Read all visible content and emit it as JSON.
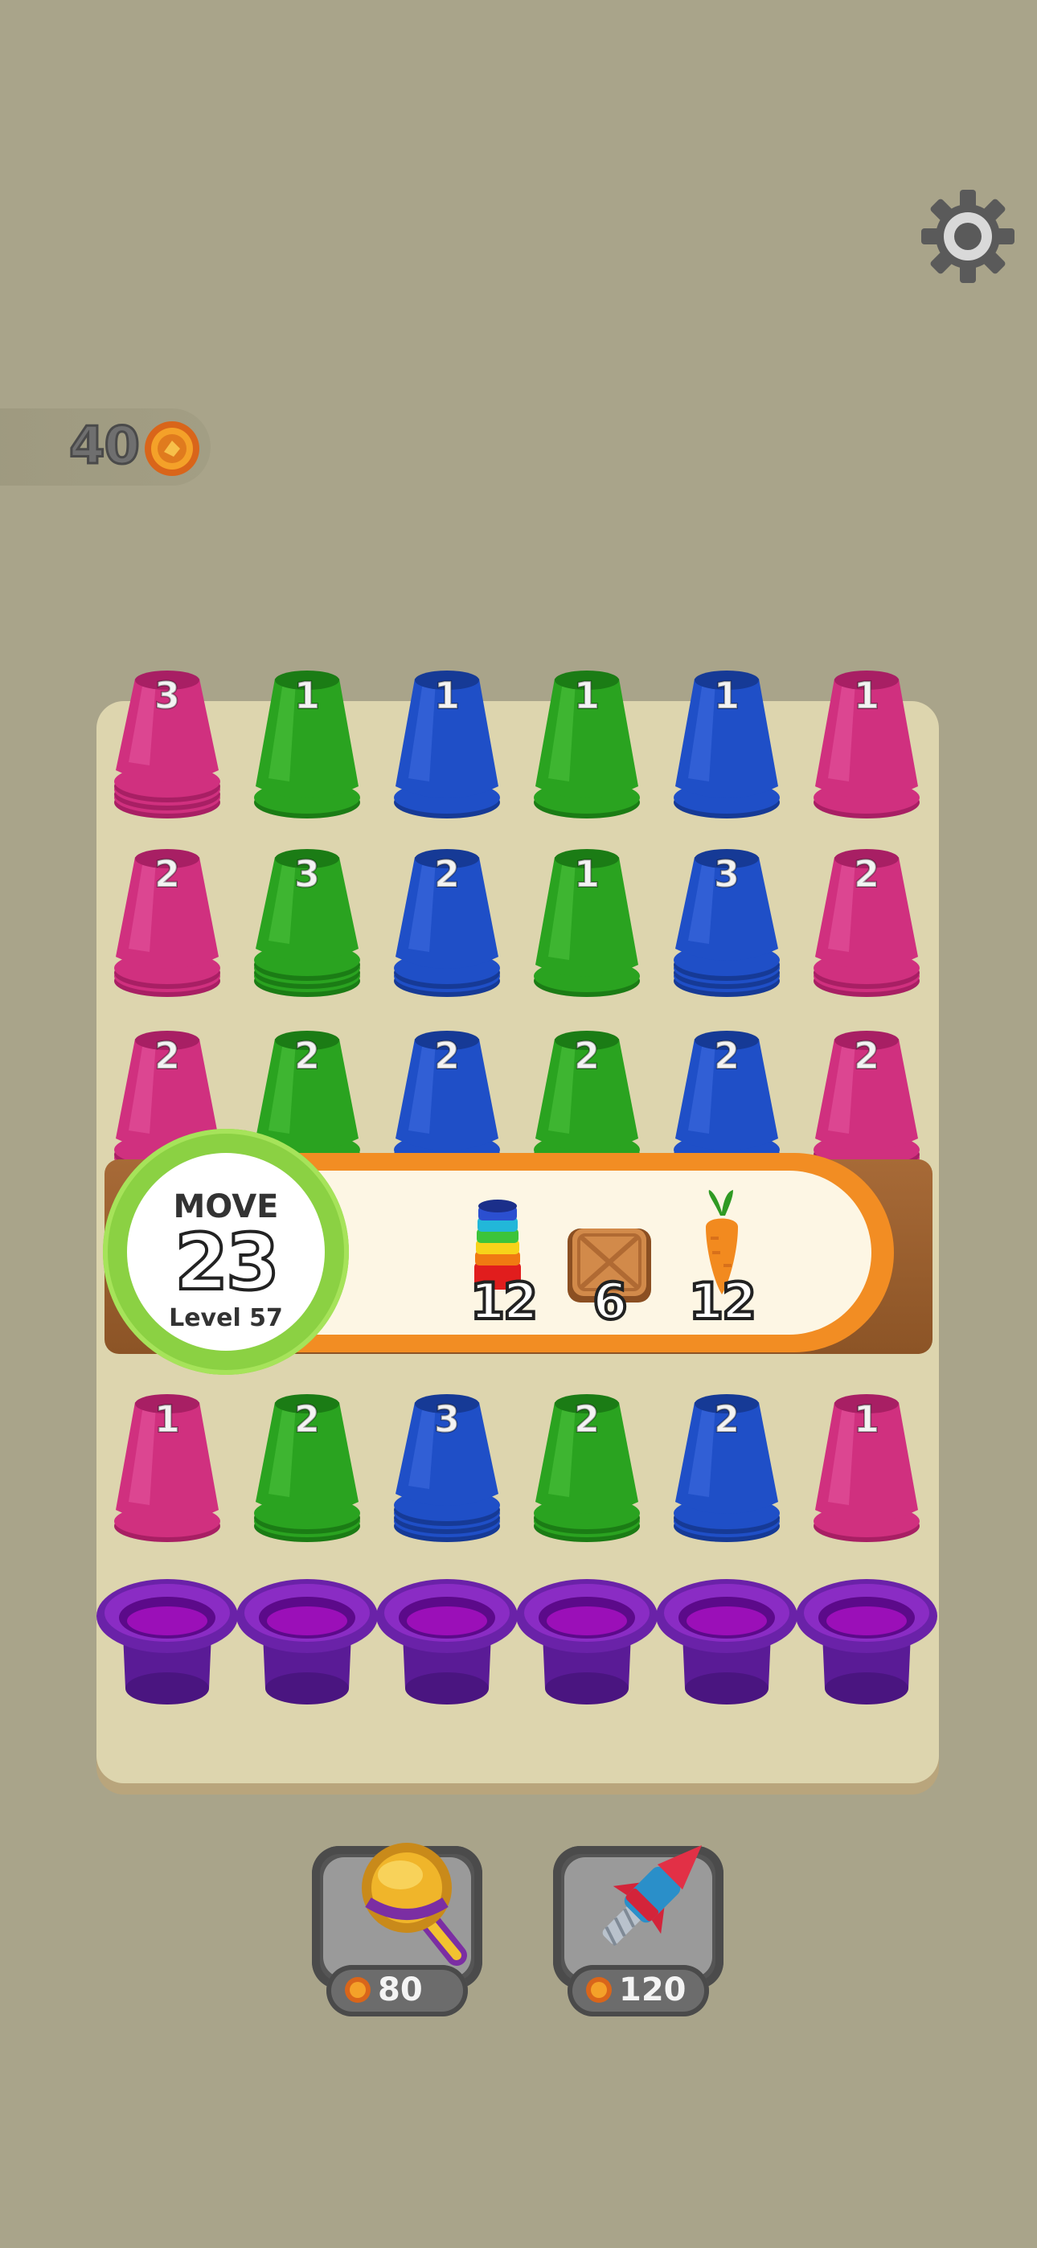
{
  "hud": {
    "coins": "40",
    "settings_icon": "gear-icon",
    "coin_icon": "coin-icon"
  },
  "board": {
    "colors": {
      "pink": "#d0307f",
      "green": "#2aa320",
      "blue": "#1f4fc7",
      "purple": "#7a1aa8"
    },
    "rows": [
      [
        {
          "color": "pink",
          "count": "3"
        },
        {
          "color": "green",
          "count": "1"
        },
        {
          "color": "blue",
          "count": "1"
        },
        {
          "color": "green",
          "count": "1"
        },
        {
          "color": "blue",
          "count": "1"
        },
        {
          "color": "pink",
          "count": "1"
        }
      ],
      [
        {
          "color": "pink",
          "count": "2"
        },
        {
          "color": "green",
          "count": "3"
        },
        {
          "color": "blue",
          "count": "2"
        },
        {
          "color": "green",
          "count": "1"
        },
        {
          "color": "blue",
          "count": "3"
        },
        {
          "color": "pink",
          "count": "2"
        }
      ],
      [
        {
          "color": "pink",
          "count": "2"
        },
        {
          "color": "green",
          "count": "2"
        },
        {
          "color": "blue",
          "count": "2"
        },
        {
          "color": "green",
          "count": "2"
        },
        {
          "color": "blue",
          "count": "2"
        },
        {
          "color": "pink",
          "count": "2"
        }
      ],
      [
        {
          "color": "pink",
          "count": "1"
        },
        {
          "color": "green",
          "count": "2"
        },
        {
          "color": "blue",
          "count": "3"
        },
        {
          "color": "green",
          "count": "2"
        },
        {
          "color": "blue",
          "count": "2"
        },
        {
          "color": "pink",
          "count": "1"
        }
      ]
    ],
    "hats": 6
  },
  "banner": {
    "move_label": "MOVE",
    "moves": "23",
    "level": "Level 57",
    "goals": [
      {
        "icon": "rainbow-stack-icon",
        "count": "12"
      },
      {
        "icon": "wooden-crate-icon",
        "count": "6"
      },
      {
        "icon": "carrot-icon",
        "count": "12"
      }
    ]
  },
  "boosters": [
    {
      "name": "magnifier-booster",
      "icon": "magnifier-icon",
      "price": "80"
    },
    {
      "name": "rocket-booster",
      "icon": "rocket-icon",
      "price": "120"
    }
  ]
}
